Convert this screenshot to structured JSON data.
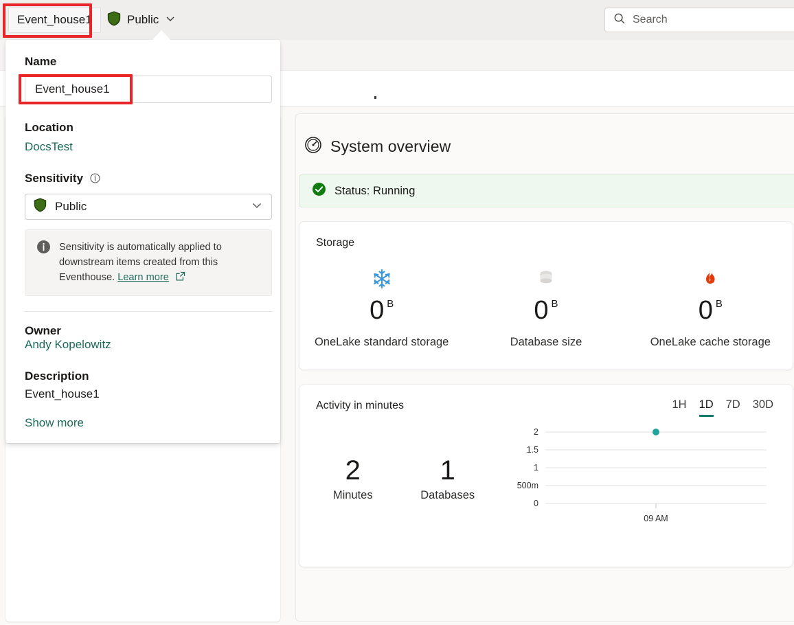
{
  "topbar": {
    "item_name": "Event_house1",
    "sensitivity_label": "Public",
    "sensitivity_icon": "shield-icon",
    "chevron_icon": "chevron-down-icon",
    "search_icon": "search-icon",
    "search_placeholder": "Search"
  },
  "details_popup": {
    "name_label": "Name",
    "name_value": "Event_house1",
    "location_label": "Location",
    "location_value": "DocsTest",
    "sensitivity_label": "Sensitivity",
    "sensitivity_info_icon": "info-circle-icon",
    "sensitivity_value": "Public",
    "sensitivity_shield_icon": "shield-icon",
    "sensitivity_chevron_icon": "chevron-down-icon",
    "info_icon": "info-filled-icon",
    "info_text": "Sensitivity is automatically applied to downstream items created from this Eventhouse.",
    "info_link": "Learn more",
    "info_link_icon": "open-in-new-icon",
    "owner_label": "Owner",
    "owner_value": "Andy Kopelowitz",
    "description_label": "Description",
    "description_value": "Event_house1",
    "show_more": "Show more"
  },
  "system_overview": {
    "icon": "gauge-icon",
    "title": "System overview",
    "status_icon": "check-circle-icon",
    "status_text": "Status: Running"
  },
  "storage_card": {
    "title": "Storage",
    "metrics": [
      {
        "icon": "snowflake-icon",
        "value": "0",
        "unit": "B",
        "label": "OneLake standard storage",
        "color": "#3a96dd"
      },
      {
        "icon": "database-icon",
        "value": "0",
        "unit": "B",
        "label": "Database size",
        "color": "#d6d4d2"
      },
      {
        "icon": "flame-icon",
        "value": "0",
        "unit": "B",
        "label": "OneLake cache storage",
        "color": "#e23b0a"
      }
    ]
  },
  "activity_card": {
    "title": "Activity in minutes",
    "ranges": [
      {
        "label": "1H",
        "active": false
      },
      {
        "label": "1D",
        "active": true
      },
      {
        "label": "7D",
        "active": false
      },
      {
        "label": "30D",
        "active": false
      }
    ],
    "kpis": [
      {
        "value": "2",
        "label": "Minutes"
      },
      {
        "value": "1",
        "label": "Databases"
      }
    ]
  },
  "chart_data": {
    "type": "scatter",
    "title": "Activity in minutes",
    "xlabel": "",
    "ylabel": "",
    "x": [
      "09 AM"
    ],
    "values": [
      2
    ],
    "series": [
      {
        "name": "Minutes",
        "values": [
          2
        ],
        "color": "#1fa39a"
      }
    ],
    "ytick_labels": [
      "2",
      "1.5",
      "1",
      "500m",
      "0"
    ],
    "ytick_values": [
      2,
      1.5,
      1,
      0.5,
      0
    ],
    "xtick_labels": [
      "09 AM"
    ],
    "ylim": [
      0,
      2
    ],
    "grid": true,
    "legend": "none",
    "point_color": "#1fa39a"
  },
  "colors": {
    "accent_teal": "#13796b",
    "link_green": "#1d6a5a",
    "highlight_red": "#e8262a",
    "status_green": "#107c10",
    "shield_green": "#3d6d14"
  }
}
